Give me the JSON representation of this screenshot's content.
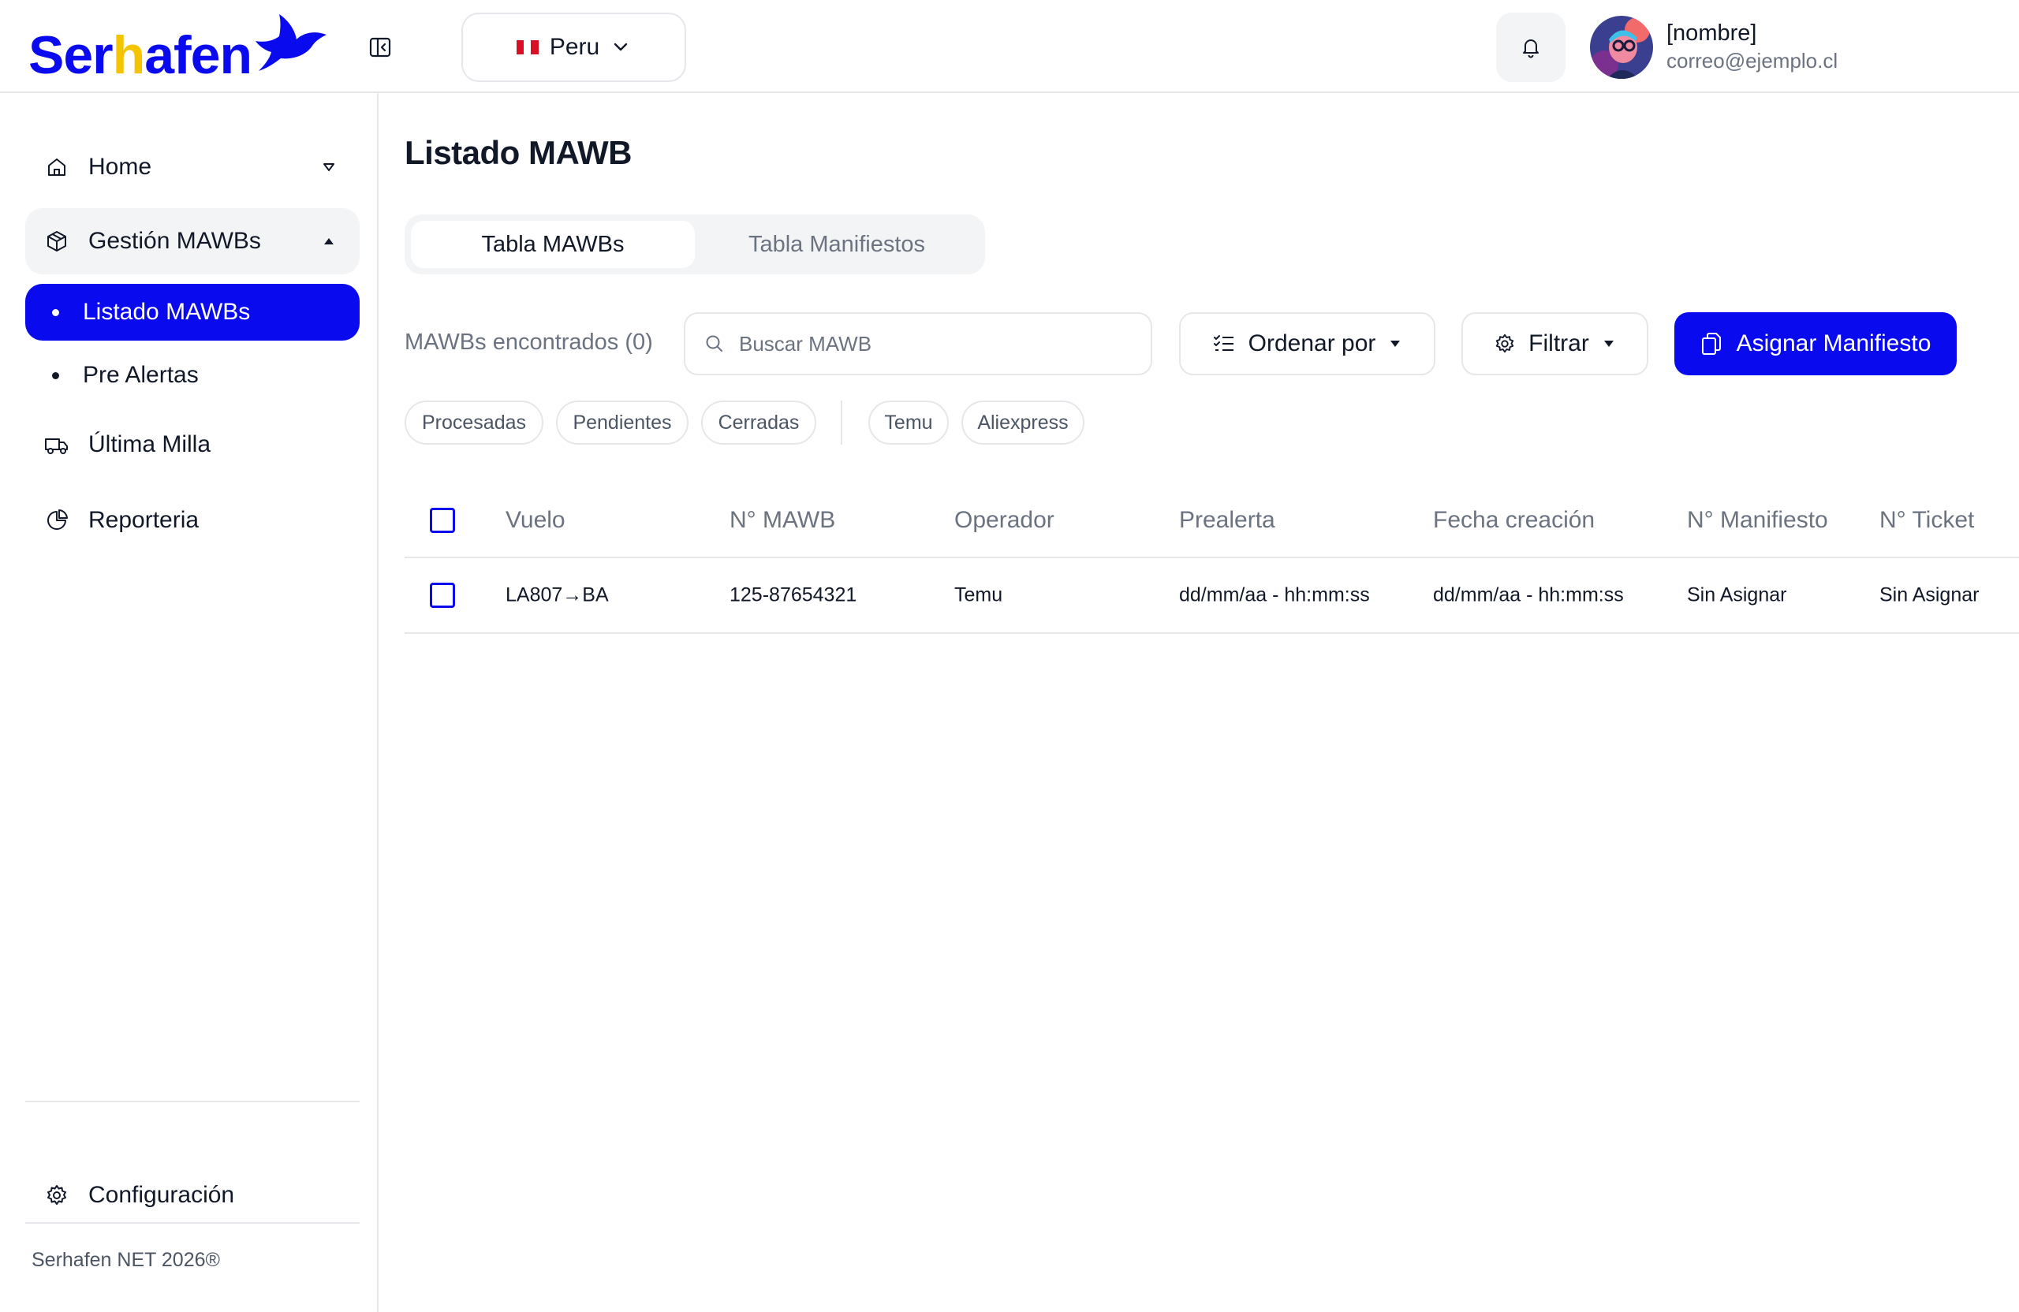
{
  "header": {
    "logo_text_pre": "Ser",
    "logo_text_h": "h",
    "logo_text_post": "afen",
    "country": "Peru",
    "user_name": "[nombre]",
    "user_email": "correo@ejemplo.cl"
  },
  "sidebar": {
    "items": [
      {
        "label": "Home",
        "icon": "home-icon"
      },
      {
        "label": "Gestión MAWBs",
        "icon": "package-icon"
      },
      {
        "label": "Listado MAWBs"
      },
      {
        "label": "Pre Alertas"
      },
      {
        "label": "Última Milla",
        "icon": "truck-icon"
      },
      {
        "label": "Reporteria",
        "icon": "pie-chart-icon"
      }
    ],
    "settings_label": "Configuración",
    "footer": "Serhafen NET 2026®"
  },
  "main": {
    "title": "Listado MAWB",
    "tabs": [
      {
        "label": "Tabla MAWBs",
        "active": true
      },
      {
        "label": "Tabla Manifiestos",
        "active": false
      }
    ],
    "found_label": "MAWBs encontrados (0)",
    "search_placeholder": "Buscar MAWB",
    "sort_label": "Ordenar por",
    "filter_label": "Filtrar",
    "assign_label": "Asignar Manifiesto",
    "chips": [
      "Procesadas",
      "Pendientes",
      "Cerradas",
      "Temu",
      "Aliexpress"
    ],
    "table": {
      "columns": [
        "Vuelo",
        "N° MAWB",
        "Operador",
        "Prealerta",
        "Fecha creación",
        "N° Manifiesto",
        "N° Ticket"
      ],
      "rows": [
        [
          "LA807→BA",
          "125-87654321",
          "Temu",
          "dd/mm/aa - hh:mm:ss",
          "dd/mm/aa - hh:mm:ss",
          "Sin Asignar",
          "Sin Asignar"
        ]
      ]
    }
  },
  "colors": {
    "accent": "#0a0aee",
    "logo_h": "#f5c400",
    "border": "#e5e7eb",
    "muted_text": "#6b7280"
  }
}
